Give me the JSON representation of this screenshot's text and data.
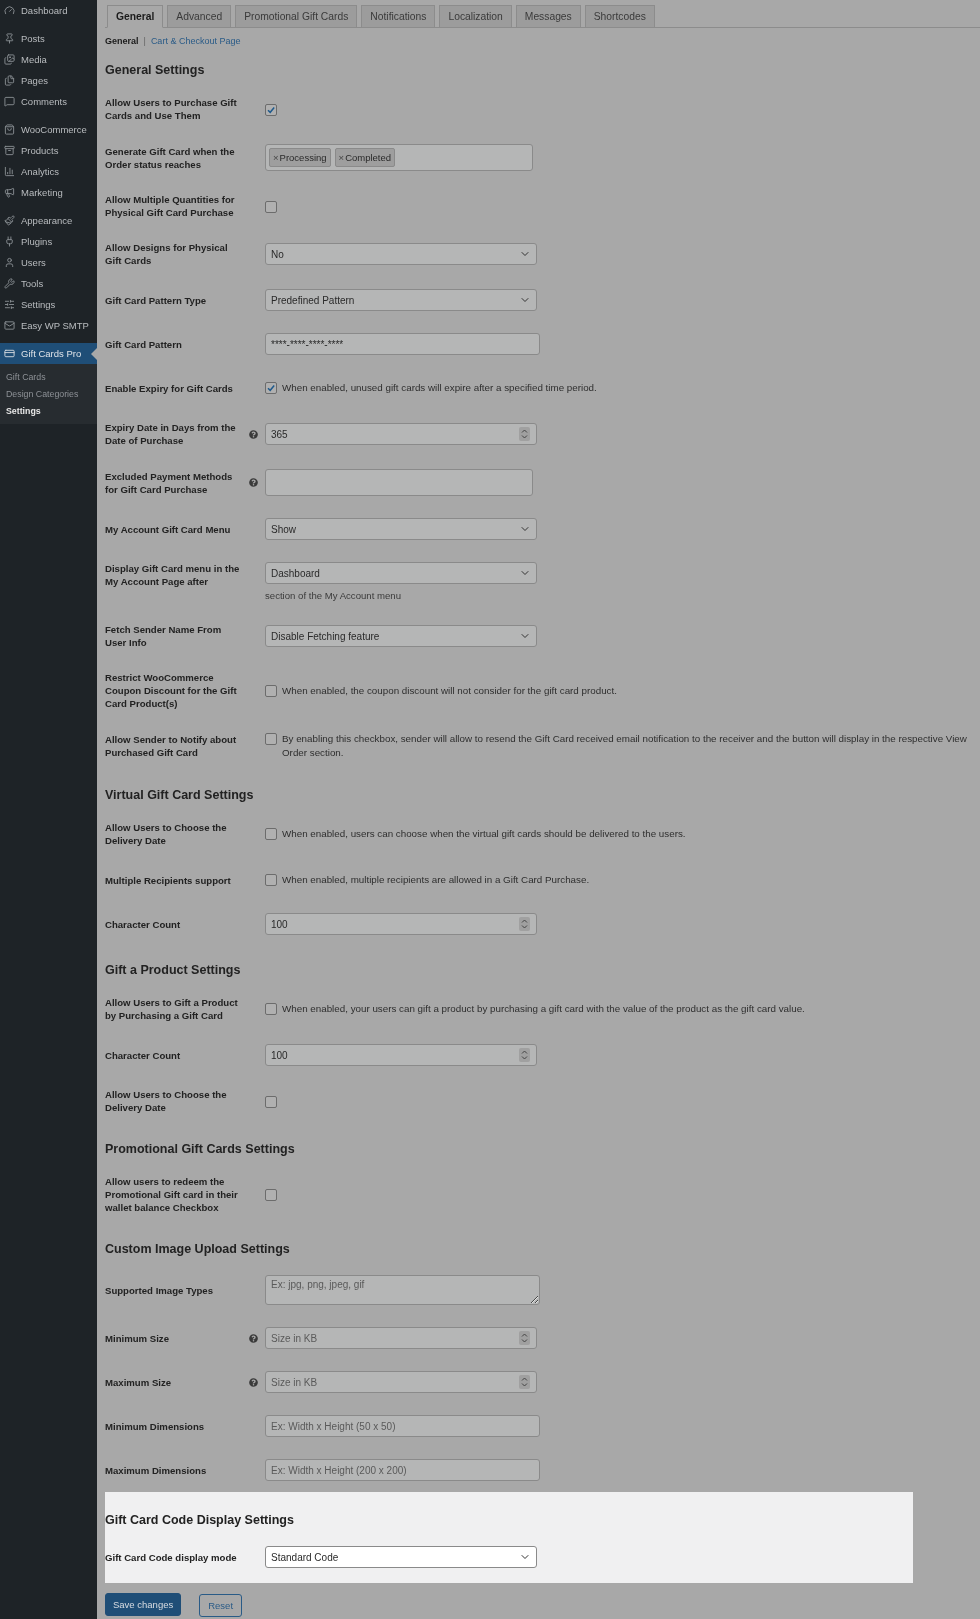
{
  "sidebar": {
    "groups": [
      {
        "items": [
          {
            "label": "Dashboard",
            "selected": false
          }
        ]
      },
      {
        "items": [
          {
            "label": "Posts",
            "selected": false
          },
          {
            "label": "Media",
            "selected": false
          },
          {
            "label": "Pages",
            "selected": false
          },
          {
            "label": "Comments",
            "selected": false
          }
        ]
      },
      {
        "items": [
          {
            "label": "WooCommerce",
            "selected": false
          },
          {
            "label": "Products",
            "selected": false
          },
          {
            "label": "Analytics",
            "selected": false
          },
          {
            "label": "Marketing",
            "selected": false
          }
        ]
      },
      {
        "items": [
          {
            "label": "Appearance",
            "selected": false
          },
          {
            "label": "Plugins",
            "selected": false
          },
          {
            "label": "Users",
            "selected": false
          },
          {
            "label": "Tools",
            "selected": false
          },
          {
            "label": "Settings",
            "selected": false
          },
          {
            "label": "Easy WP SMTP",
            "selected": false
          }
        ]
      },
      {
        "items": [
          {
            "label": "Gift Cards Pro",
            "selected": true,
            "children": [
              {
                "label": "Gift Cards",
                "selected": false
              },
              {
                "label": "Design Categories",
                "selected": false
              },
              {
                "label": "Settings",
                "selected": true
              }
            ]
          }
        ]
      }
    ]
  },
  "tabs": [
    {
      "label": "General",
      "selected": true
    },
    {
      "label": "Advanced",
      "selected": false
    },
    {
      "label": "Promotional Gift Cards",
      "selected": false
    },
    {
      "label": "Notifications",
      "selected": false
    },
    {
      "label": "Localization",
      "selected": false
    },
    {
      "label": "Messages",
      "selected": false
    },
    {
      "label": "Shortcodes",
      "selected": false
    }
  ],
  "subnav": {
    "separator": "|",
    "links": [
      {
        "label": "General",
        "selected": true
      },
      {
        "label": "Cart & Checkout Page",
        "selected": false
      }
    ]
  },
  "sections": [
    {
      "title": "General Settings",
      "highlighted": false,
      "rows": [
        {
          "label": "Allow Users to Purchase Gift Cards and Use Them",
          "kind": "checkbox",
          "checked": true
        },
        {
          "label": "Generate Gift Card when the Order status reaches",
          "kind": "tags",
          "tags": [
            {
              "remove": "×",
              "label": "Processing"
            },
            {
              "remove": "×",
              "label": "Completed"
            }
          ]
        },
        {
          "label": "Allow Multiple Quantities for Physical Gift Card Purchase",
          "kind": "checkbox",
          "checked": false
        },
        {
          "label": "Allow Designs for Physical Gift Cards",
          "kind": "select",
          "value": "No"
        },
        {
          "label": "Gift Card Pattern Type",
          "kind": "select",
          "value": "Predefined Pattern"
        },
        {
          "label": "Gift Card Pattern",
          "kind": "text",
          "value": "****-****-****-****"
        },
        {
          "label": "Enable Expiry for Gift Cards",
          "kind": "checkbox",
          "checked": true,
          "description": "When enabled, unused gift cards will expire after a specified time period."
        },
        {
          "label": "Expiry Date in Days from the Date of Purchase",
          "help": true,
          "kind": "number",
          "value": "365"
        },
        {
          "label": "Excluded Payment Methods for Gift Card Purchase",
          "help": true,
          "kind": "tags",
          "tags": []
        },
        {
          "label": "My Account Gift Card Menu",
          "kind": "select",
          "value": "Show"
        },
        {
          "label": "Display Gift Card menu in the My Account Page after",
          "kind": "select",
          "value": "Dashboard",
          "note": "section of the My Account menu"
        },
        {
          "label": "Fetch Sender Name From User Info",
          "kind": "select",
          "value": "Disable Fetching feature"
        },
        {
          "label": "Restrict WooCommerce Coupon Discount for the Gift Card Product(s)",
          "kind": "checkbox",
          "checked": false,
          "description": "When enabled, the coupon discount will not consider for the gift card product."
        },
        {
          "label": "Allow Sender to Notify about Purchased Gift Card",
          "kind": "checkbox",
          "checked": false,
          "description": "By enabling this checkbox, sender will allow to resend the Gift Card received email notification to the receiver and the button will display in the respective View Order section."
        }
      ]
    },
    {
      "title": "Virtual Gift Card Settings",
      "highlighted": false,
      "rows": [
        {
          "label": "Allow Users to Choose the Delivery Date",
          "kind": "checkbox",
          "checked": false,
          "description": "When enabled, users can choose when the virtual gift cards should be delivered to the users."
        },
        {
          "label": "Multiple Recipients support",
          "kind": "checkbox",
          "checked": false,
          "description": "When enabled, multiple recipients are allowed in a Gift Card Purchase."
        },
        {
          "label": "Character Count",
          "kind": "number",
          "value": "100"
        }
      ]
    },
    {
      "title": "Gift a Product Settings",
      "highlighted": false,
      "rows": [
        {
          "label": "Allow Users to Gift a Product by Purchasing a Gift Card",
          "kind": "checkbox",
          "checked": false,
          "description": "When enabled, your users can gift a product by purchasing a gift card with the value of the product as the gift card value."
        },
        {
          "label": "Character Count",
          "kind": "number",
          "value": "100"
        },
        {
          "label": "Allow Users to Choose the Delivery Date",
          "kind": "checkbox",
          "checked": false
        }
      ]
    },
    {
      "title": "Promotional Gift Cards Settings",
      "highlighted": false,
      "rows": [
        {
          "label": "Allow users to redeem the Promotional Gift card in their wallet balance Checkbox",
          "kind": "checkbox",
          "checked": false
        }
      ]
    },
    {
      "title": "Custom Image Upload Settings",
      "highlighted": false,
      "rows": [
        {
          "label": "Supported Image Types",
          "kind": "textarea",
          "placeholder": "Ex: jpg, png, jpeg, gif"
        },
        {
          "label": "Minimum Size",
          "help": true,
          "kind": "number",
          "placeholder": "Size in KB"
        },
        {
          "label": "Maximum Size",
          "help": true,
          "kind": "number",
          "placeholder": "Size in KB"
        },
        {
          "label": "Minimum Dimensions",
          "kind": "text",
          "placeholder": "Ex: Width x Height (50 x 50)"
        },
        {
          "label": "Maximum Dimensions",
          "kind": "text",
          "placeholder": "Ex: Width x Height (200 x 200)"
        }
      ]
    },
    {
      "title": "Gift Card Code Display Settings",
      "highlighted": true,
      "rows": [
        {
          "label": "Gift Card Code display mode",
          "kind": "select",
          "value": "Standard Code"
        }
      ]
    }
  ],
  "buttons": [
    {
      "label": "Save changes",
      "kind": "primary"
    },
    {
      "label": "Reset",
      "kind": "secondary"
    }
  ]
}
